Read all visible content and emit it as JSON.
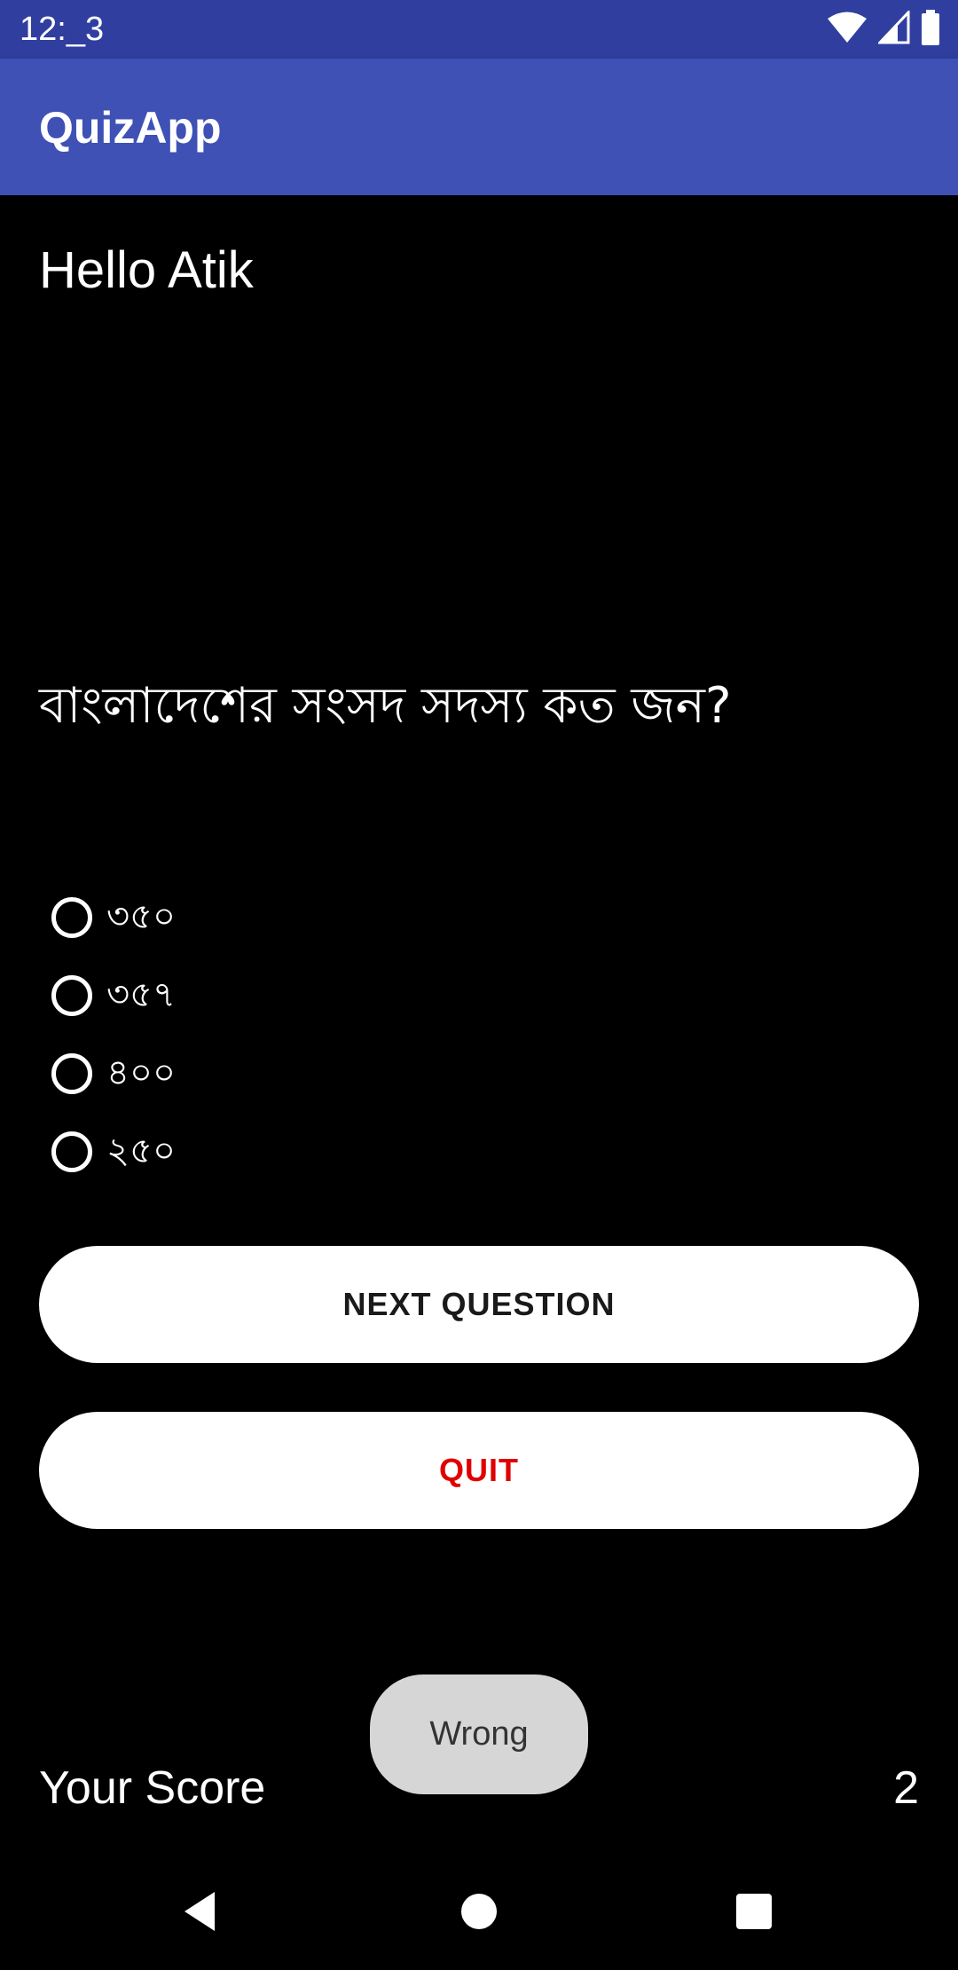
{
  "status_bar": {
    "time": "12:_3",
    "icons": [
      "wifi-icon",
      "signal-icon",
      "battery-icon"
    ]
  },
  "app_bar": {
    "title": "QuizApp"
  },
  "greeting": "Hello Atik",
  "question": "বাংলাদেশের সংসদ সদস্য কত জন?",
  "options": [
    {
      "label": "৩৫০",
      "selected": false
    },
    {
      "label": "৩৫৭",
      "selected": false
    },
    {
      "label": "৪০০",
      "selected": false
    },
    {
      "label": "২৫০",
      "selected": false
    }
  ],
  "buttons": {
    "next_label": "NEXT QUESTION",
    "quit_label": "QUIT"
  },
  "score": {
    "label": "Your Score",
    "value": "2"
  },
  "toast": "Wrong",
  "nav_bar": {
    "icons": [
      "back-icon",
      "home-icon",
      "recents-icon"
    ]
  },
  "colors": {
    "status_bar": "#303f9f",
    "app_bar": "#3f51b5",
    "background": "#000000",
    "quit_text": "#e00000",
    "toast_bg": "#d6d6d6"
  }
}
